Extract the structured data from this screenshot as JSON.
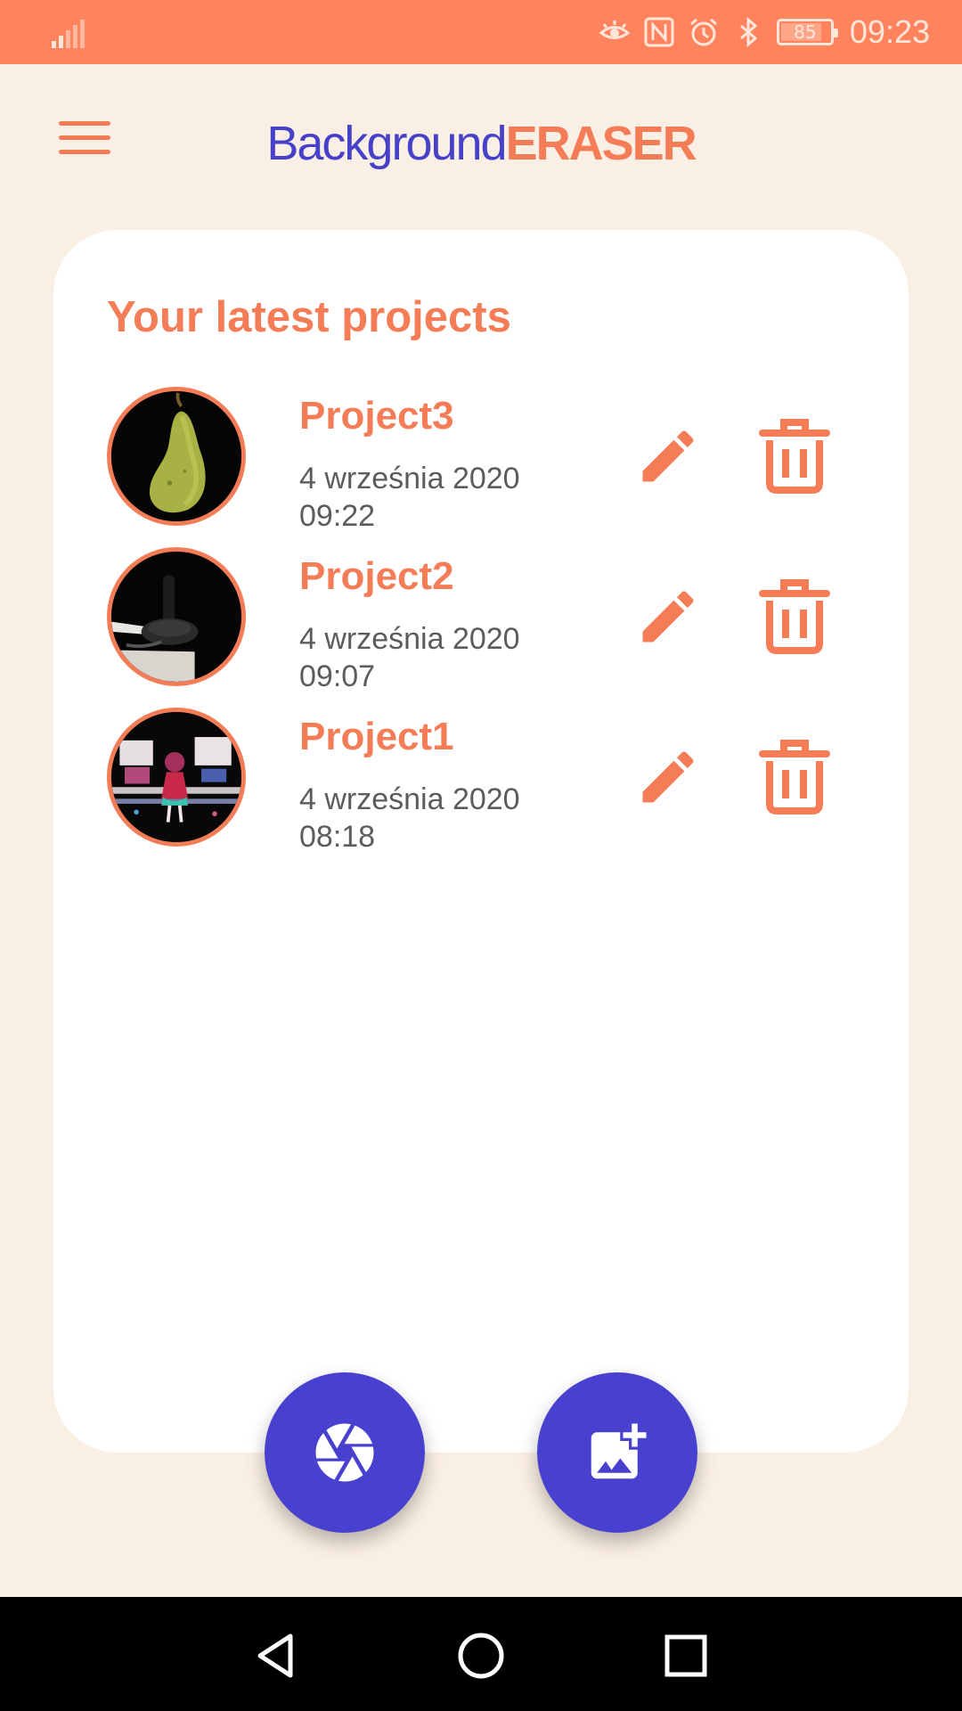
{
  "status_bar": {
    "time": "09:23",
    "battery": "85",
    "battery_level": 0.85,
    "icons": [
      "signal-icon",
      "eye-icon",
      "nfc-icon",
      "alarm-icon",
      "bluetooth-icon",
      "battery-icon"
    ]
  },
  "header": {
    "menu_icon": "hamburger-menu-icon",
    "logo_part1": "Background",
    "logo_part2": "ERASER"
  },
  "projects_card": {
    "title": "Your latest projects",
    "projects": [
      {
        "name": "Project3",
        "date": "4 września 2020",
        "time": "09:22",
        "thumbnail": "pear"
      },
      {
        "name": "Project2",
        "date": "4 września 2020",
        "time": "09:07",
        "thumbnail": "joystick"
      },
      {
        "name": "Project1",
        "date": "4 września 2020",
        "time": "08:18",
        "thumbnail": "anime-figure"
      }
    ],
    "row_actions": {
      "edit_icon": "pencil-icon",
      "delete_icon": "trash-icon"
    }
  },
  "fabs": {
    "camera_icon": "camera-shutter-icon",
    "add_image_icon": "add-image-icon"
  },
  "nav_bar": {
    "icons": [
      "back-triangle-icon",
      "home-circle-icon",
      "recent-square-icon"
    ]
  },
  "colors": {
    "accent_orange": "#f47d57",
    "status_bar": "#ff845e",
    "primary_indigo": "#4840cf",
    "background": "#faefe4",
    "card": "#ffffff",
    "date_text": "#5c5c5c"
  }
}
